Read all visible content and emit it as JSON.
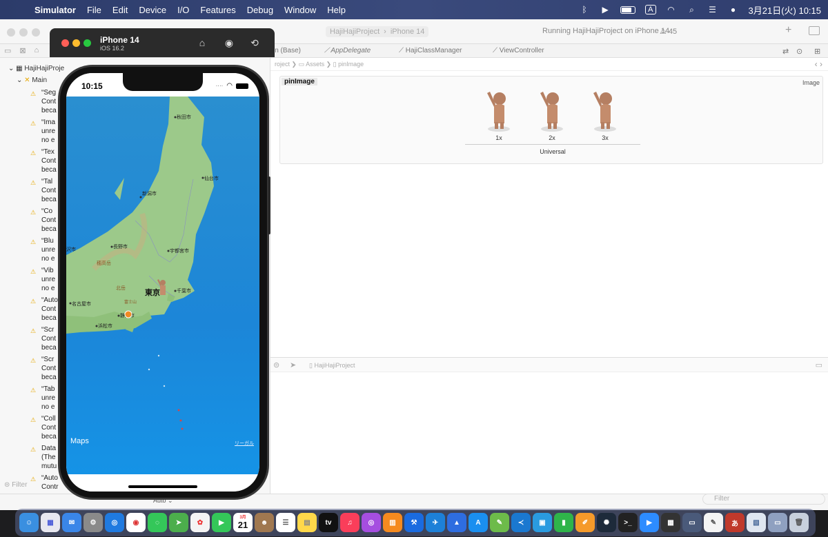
{
  "menubar": {
    "app_name": "Simulator",
    "items": [
      "File",
      "Edit",
      "Device",
      "I/O",
      "Features",
      "Debug",
      "Window",
      "Help"
    ],
    "input_indicator": "A",
    "datetime": "3月21日(火)  10:15"
  },
  "xcode": {
    "scheme": "HajiHajiProject",
    "device": "iPhone 14",
    "status": "Running HajiHajiProject on iPhone 14",
    "warning_count": "45",
    "tabs": [
      "in (Base)",
      "AppDelegate",
      "HajiClassManager",
      "ViewController"
    ],
    "jump_bar": [
      "roject",
      "Assets",
      "pinImage"
    ],
    "navigator": {
      "project": "HajiHajiProje",
      "group": "Main",
      "issues": [
        {
          "lines": [
            "“Seg",
            "Cont",
            "beca"
          ]
        },
        {
          "lines": [
            "“Ima",
            "unre",
            "no e"
          ]
        },
        {
          "lines": [
            "“Tex",
            "Cont",
            "beca"
          ]
        },
        {
          "lines": [
            "“Tal",
            "Cont",
            "beca"
          ]
        },
        {
          "lines": [
            "“Co",
            "Cont",
            "beca"
          ]
        },
        {
          "lines": [
            "“Blu",
            "unre",
            "no e"
          ]
        },
        {
          "lines": [
            "“Vib",
            "unre",
            "no e"
          ]
        },
        {
          "lines": [
            "“Auto",
            "Cont",
            "beca"
          ]
        },
        {
          "lines": [
            "“Scr",
            "Cont",
            "beca"
          ]
        },
        {
          "lines": [
            "“Scr",
            "Cont",
            "beca"
          ]
        },
        {
          "lines": [
            "“Tab",
            "unre",
            "no e"
          ]
        },
        {
          "lines": [
            "“Coll",
            "Cont",
            "beca"
          ]
        },
        {
          "lines": [
            "Data",
            "(The",
            "mutu"
          ]
        },
        {
          "lines": [
            "“Auto",
            "Contr",
            ""
          ]
        }
      ],
      "filter_placeholder": "Filter"
    },
    "asset": {
      "name": "pinImage",
      "type": "Image",
      "slots": [
        "1x",
        "2x",
        "3x"
      ],
      "universal": "Universal"
    },
    "debug": {
      "crumb": "HajiHajiProject",
      "auto_label": "Auto ⌄",
      "filter_placeholder": "Filter"
    }
  },
  "simulator": {
    "device_name": "iPhone 14",
    "os_version": "iOS 16.2",
    "status_time": "10:15",
    "map": {
      "cities": {
        "akita": "秋田市",
        "sendai": "仙台市",
        "niigata": "新潟市",
        "nagano": "長野市",
        "utsunomiya": "宇都宮市",
        "kanazawa": "沢市",
        "tokyo": "東京",
        "chiba": "千葉市",
        "nagoya": "名古屋市",
        "shizuoka": "静岡市",
        "hamamatsu": "浜松市",
        "yokotake": "穂高岳",
        "kitadake": "北岳",
        "fuji": "富士山"
      },
      "logo": "Maps",
      "legal": "リーガル"
    }
  },
  "dock": {
    "calendar_day": "21",
    "calendar_month": "3月",
    "tv_label": "tv",
    "japanese_char": "あ"
  }
}
